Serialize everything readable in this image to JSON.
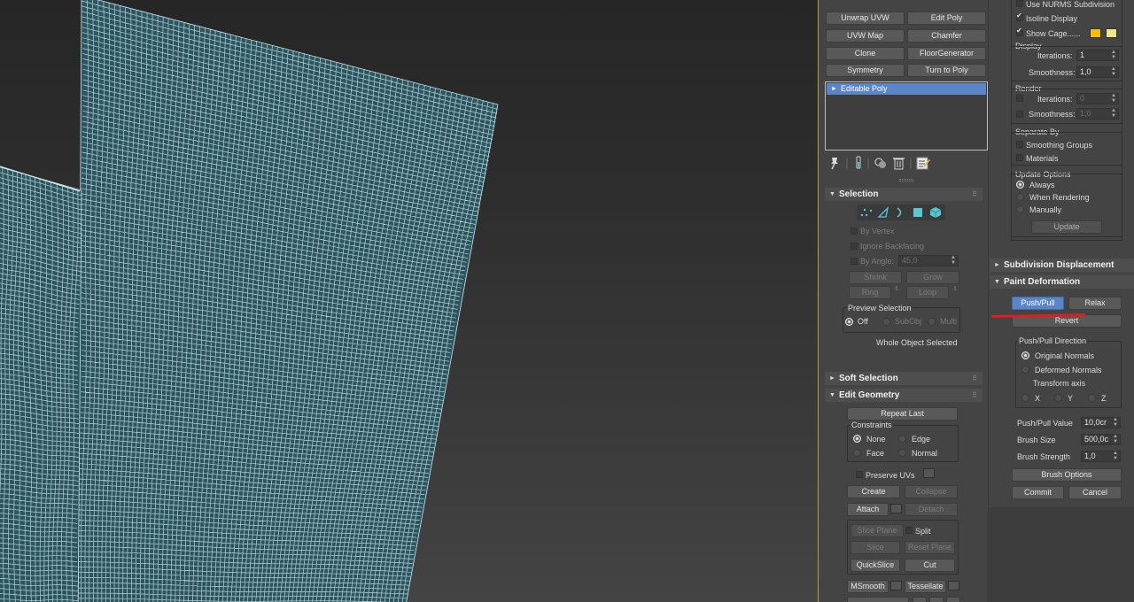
{
  "colors": {
    "cage_color_1": "#f5c000",
    "cage_color_2": "#f2e68a",
    "accent_blue": "#5a86c8",
    "annotation_red": "#e11d1d",
    "mesh": "#cfe9ee"
  },
  "mod_buttons": [
    "Unwrap UVW",
    "Edit Poly",
    "UVW Map",
    "Chamfer",
    "Clone",
    "FloorGenerator",
    "Symmetry",
    "Turn to Poly"
  ],
  "modifier_stack": {
    "items": [
      "Editable Poly"
    ]
  },
  "stack_toolbar": {
    "icons": [
      "pin-stack-icon",
      "show-end-result-icon",
      "make-unique-icon",
      "remove-modifier-icon",
      "configure-modifier-sets-icon"
    ]
  },
  "selection": {
    "title": "Selection",
    "levels": [
      "vertex-icon",
      "edge-icon",
      "border-icon",
      "polygon-icon",
      "element-icon"
    ],
    "by_vertex": "By Vertex",
    "ignore_backfacing": "Ignore Backfacing",
    "by_angle": "By Angle:",
    "by_angle_value": "45,0",
    "shrink": "Shrink",
    "grow": "Grow",
    "ring": "Ring",
    "loop": "Loop",
    "preview_selection": "Preview Selection",
    "preview_off": "Off",
    "preview_subobj": "SubObj",
    "preview_multi": "Multi",
    "status": "Whole Object Selected"
  },
  "soft_selection": {
    "title": "Soft Selection"
  },
  "edit_geometry": {
    "title": "Edit Geometry",
    "repeat_last": "Repeat Last",
    "constraints": "Constraints",
    "none": "None",
    "edge": "Edge",
    "face": "Face",
    "normal": "Normal",
    "preserve_uvs": "Preserve UVs",
    "create": "Create",
    "collapse": "Collapse",
    "attach": "Attach",
    "detach": "Detach",
    "slice_plane": "Slice Plane",
    "split": "Split",
    "slice": "Slice",
    "reset_plane": "Reset Plane",
    "quickslice": "QuickSlice",
    "cut": "Cut",
    "msmooth": "MSmooth",
    "tessellate": "Tessellate"
  },
  "subdivision": {
    "use_nurms": "Use NURMS Subdivision",
    "isoline_display": "Isoline Display",
    "show_cage": "Show Cage......",
    "display": "Display",
    "iterations": "Iterations:",
    "iterations_value": "1",
    "smoothness": "Smoothness:",
    "smoothness_value": "1,0",
    "render": "Render",
    "render_iterations_value": "0",
    "render_smoothness_value": "1,0",
    "separate_by": "Separate By",
    "smoothing_groups": "Smoothing Groups",
    "materials": "Materials",
    "update_options": "Update Options",
    "always": "Always",
    "when_rendering": "When Rendering",
    "manually": "Manually",
    "update": "Update"
  },
  "subdivision_displacement": {
    "title": "Subdivision Displacement"
  },
  "paint_deformation": {
    "title": "Paint Deformation",
    "push_pull": "Push/Pull",
    "relax": "Relax",
    "revert": "Revert",
    "direction": "Push/Pull Direction",
    "original_normals": "Original Normals",
    "deformed_normals": "Deformed Normals",
    "transform_axis": "Transform axis",
    "x": "X",
    "y": "Y",
    "z": "Z",
    "push_pull_value": "Push/Pull Value",
    "push_pull_value_v": "10,0cr",
    "brush_size": "Brush Size",
    "brush_size_v": "500,0c",
    "brush_strength": "Brush Strength",
    "brush_strength_v": "1,0",
    "brush_options": "Brush Options",
    "commit": "Commit",
    "cancel": "Cancel"
  }
}
